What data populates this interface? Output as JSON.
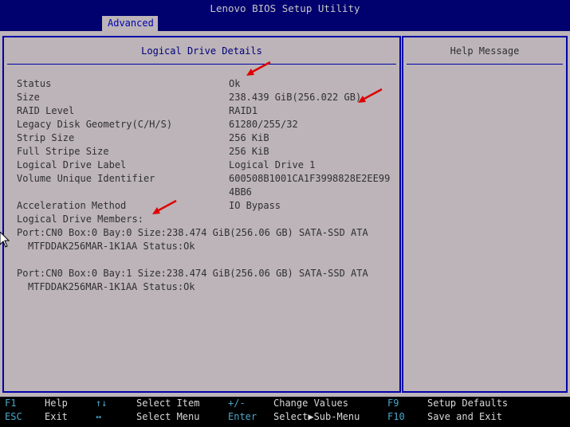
{
  "window": {
    "title": "Lenovo BIOS Setup Utility"
  },
  "tabs": [
    {
      "label": "Advanced",
      "selected": true
    }
  ],
  "left_panel": {
    "title": "Logical Drive Details"
  },
  "details": [
    {
      "label": "Status",
      "value": "Ok"
    },
    {
      "label": "Size",
      "value": "238.439 GiB(256.022 GB)"
    },
    {
      "label": "RAID Level",
      "value": "RAID1"
    },
    {
      "label": "Legacy Disk Geometry(C/H/S)",
      "value": "61280/255/32"
    },
    {
      "label": "Strip Size",
      "value": "256 KiB"
    },
    {
      "label": "Full Stripe Size",
      "value": "256 KiB"
    },
    {
      "label": "Logical Drive Label",
      "value": "Logical Drive 1"
    },
    {
      "label": "Volume Unique Identifier",
      "value": "600508B1001CA1F3998828E2EE99",
      "value_line2": "4BB6"
    },
    {
      "label": "Acceleration Method",
      "value": "IO Bypass"
    },
    {
      "label": "Logical Drive Members:",
      "value": ""
    }
  ],
  "members": [
    {
      "line1": "Port:CN0 Box:0 Bay:0 Size:238.474 GiB(256.06 GB) SATA-SSD ATA",
      "line2": "MTFDDAK256MAR-1K1AA Status:Ok"
    },
    {
      "line1": "Port:CN0 Box:0 Bay:1 Size:238.474 GiB(256.06 GB) SATA-SSD ATA",
      "line2": "MTFDDAK256MAR-1K1AA Status:Ok"
    }
  ],
  "right_panel": {
    "title": "Help Message"
  },
  "footer": {
    "items": [
      {
        "key": "F1",
        "desc": "Help"
      },
      {
        "key": "ESC",
        "desc": "Exit"
      },
      {
        "key": "↑↓",
        "desc": "Select Item"
      },
      {
        "key": "↔",
        "desc": "Select Menu"
      },
      {
        "key": "+/-",
        "desc": "Change Values"
      },
      {
        "key": "Enter",
        "desc": "Select▶Sub-Menu"
      },
      {
        "key": "F9",
        "desc": "Setup Defaults"
      },
      {
        "key": "F10",
        "desc": "Save and Exit"
      }
    ]
  },
  "colors": {
    "title_bar": "#00006e",
    "panel_bg": "#bcb4b8",
    "panel_border": "#0000a8",
    "annotation_arrow": "#e00000",
    "footer_key": "#4aa6c8"
  }
}
